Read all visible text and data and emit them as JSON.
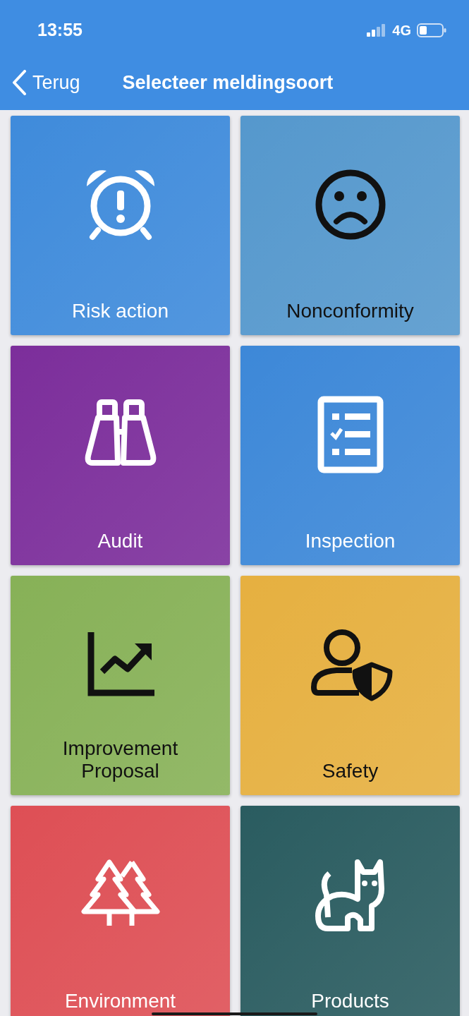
{
  "status_bar": {
    "time": "13:55",
    "network": "4G"
  },
  "nav_bar": {
    "back_label": "Terug",
    "title": "Selecteer meldingsoort"
  },
  "tiles": [
    {
      "label": "Risk action",
      "color": "#3f8bdb",
      "dark_text": false
    },
    {
      "label": "Nonconformity",
      "color": "#5598cd",
      "dark_text": true
    },
    {
      "label": "Audit",
      "color": "#7c2e9b",
      "dark_text": false
    },
    {
      "label": "Inspection",
      "color": "#3d88d8",
      "dark_text": false
    },
    {
      "label": "Improvement Proposal",
      "color": "#87b157",
      "dark_text": true
    },
    {
      "label": "Safety",
      "color": "#e6b040",
      "dark_text": true
    },
    {
      "label": "Environment",
      "color": "#de4f55",
      "dark_text": false
    },
    {
      "label": "Products",
      "color": "#2a5c60",
      "dark_text": false
    }
  ]
}
